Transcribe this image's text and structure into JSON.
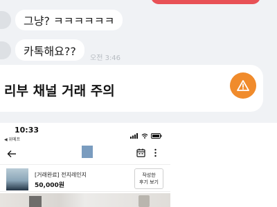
{
  "chat": {
    "messages": [
      {
        "text": "그냥? ㅋㅋㅋㅋㅋㅋ"
      },
      {
        "text": "카톡해요??"
      }
    ],
    "time": "오전 3:46",
    "notice": {
      "text": "리부 채널 거래 주의"
    },
    "colors": {
      "warning": "#f08b2c",
      "sent_bubble": "#e85156",
      "background": "#f0f2f5"
    }
  },
  "phone": {
    "status_time": "10:33",
    "back_label": "◀ 위메프",
    "product": {
      "title": "[거래완료] 전지레인지",
      "price": "50,000원",
      "review_button": {
        "line1": "작성한",
        "line2": "후기 보기"
      }
    },
    "icons": [
      "back-arrow-icon",
      "calendar-icon",
      "more-vertical-icon",
      "wifi-icon",
      "battery-icon",
      "signal-icon",
      "warning-icon"
    ]
  }
}
